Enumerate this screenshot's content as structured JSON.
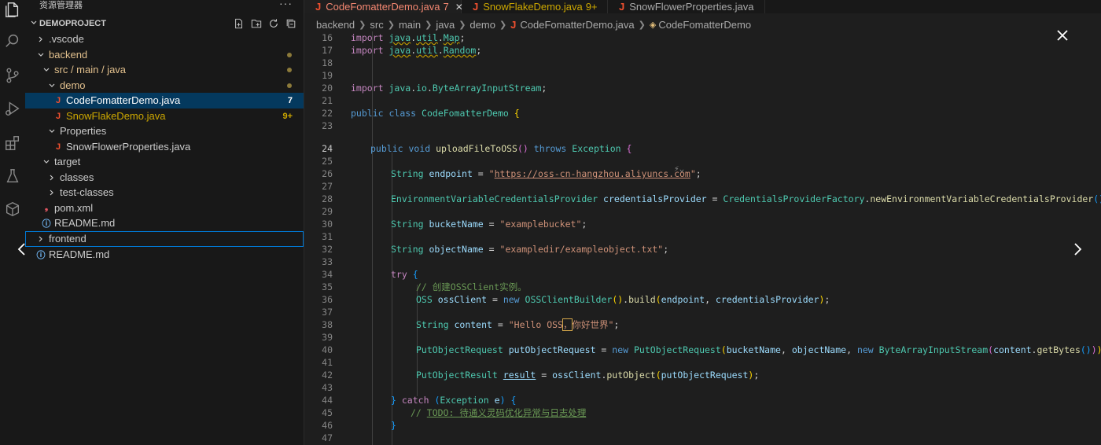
{
  "sidebar": {
    "title": "资源管理器",
    "more": "···",
    "project": "DEMOPROJECT",
    "tree": [
      {
        "label": ".vscode"
      },
      {
        "label": "backend"
      },
      {
        "label": "src / main / java"
      },
      {
        "label": "demo"
      },
      {
        "label": "CodeFomatterDemo.java",
        "badge": "7"
      },
      {
        "label": "SnowFlakeDemo.java",
        "badge": "9+"
      },
      {
        "label": "Properties"
      },
      {
        "label": "SnowFlowerProperties.java"
      },
      {
        "label": "target"
      },
      {
        "label": "classes"
      },
      {
        "label": "test-classes"
      },
      {
        "label": "pom.xml"
      },
      {
        "label": "README.md"
      },
      {
        "label": "frontend"
      },
      {
        "label": "README.md"
      }
    ]
  },
  "tabs": [
    {
      "label": "CodeFomatterDemo.java",
      "badge": "7",
      "close": "✕"
    },
    {
      "label": "SnowFlakeDemo.java",
      "badge": "9+"
    },
    {
      "label": "SnowFlowerProperties.java"
    }
  ],
  "breadcrumb": [
    "backend",
    "src",
    "main",
    "java",
    "demo",
    "CodeFomatterDemo.java",
    "CodeFomatterDemo"
  ],
  "editor": {
    "lines": [
      "16",
      "17",
      "18",
      "19",
      "20",
      "21",
      "22",
      "23",
      "24",
      "25",
      "26",
      "27",
      "28",
      "29",
      "30",
      "31",
      "32",
      "33",
      "34",
      "35",
      "36",
      "37",
      "38",
      "39",
      "40",
      "41",
      "42",
      "43",
      "44",
      "45",
      "46",
      "47"
    ],
    "codelens": "⚡︎⌄"
  },
  "icons": {
    "explorer": "files-icon",
    "search": "search-icon",
    "scm": "source-control-icon",
    "debug": "run-debug-icon",
    "extensions": "extensions-icon",
    "testing": "flask-icon"
  }
}
